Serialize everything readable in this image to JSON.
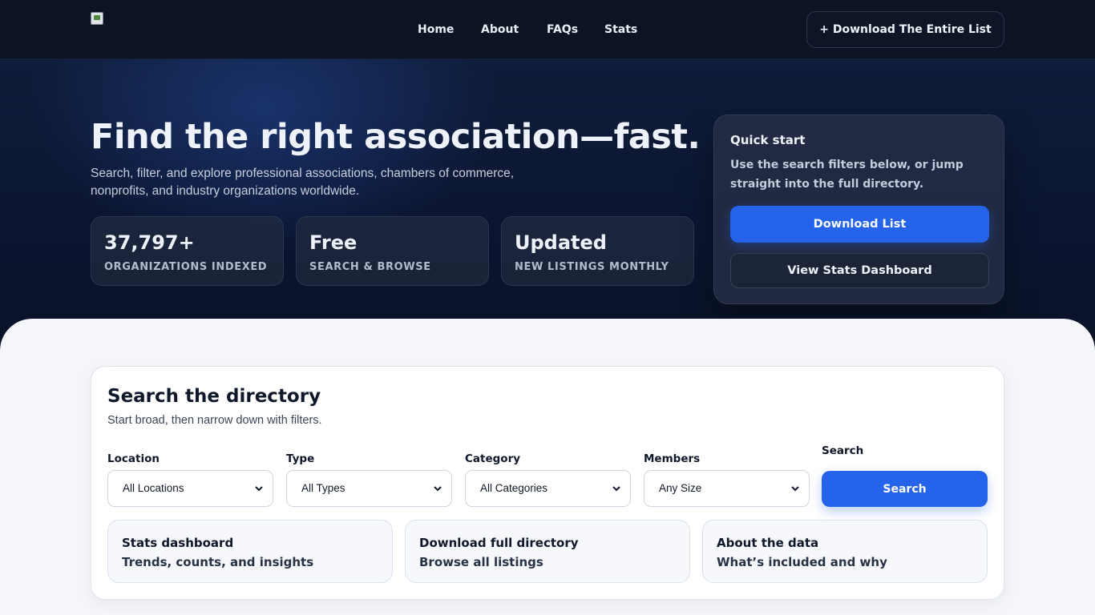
{
  "nav": {
    "links": [
      "Home",
      "About",
      "FAQs",
      "Stats"
    ],
    "cta_label": "+ Download The Entire List"
  },
  "hero": {
    "title": "Find the right association—fast.",
    "subtitle_line1": "Search, filter, and explore professional associations, chambers of commerce,",
    "subtitle_line2": "nonprofits, and industry organizations worldwide.",
    "stats": [
      {
        "value": "37,797+",
        "label": "ORGANIZATIONS INDEXED"
      },
      {
        "value": "Free",
        "label": "SEARCH & BROWSE"
      },
      {
        "value": "Updated",
        "label": "NEW LISTINGS MONTHLY"
      }
    ]
  },
  "quick_start": {
    "title": "Quick start",
    "text": "Use the search filters below, or jump straight into the full directory.",
    "primary_label": "Download List",
    "secondary_label": "View Stats Dashboard"
  },
  "search": {
    "title": "Search the directory",
    "subtitle": "Start broad, then narrow down with filters.",
    "filters": [
      {
        "label": "Location",
        "value": "All Locations"
      },
      {
        "label": "Type",
        "value": "All Types"
      },
      {
        "label": "Category",
        "value": "All Categories"
      },
      {
        "label": "Members",
        "value": "Any Size"
      }
    ],
    "search_label": "Search",
    "search_button": "Search",
    "links": [
      {
        "title": "Stats dashboard",
        "subtitle": "Trends, counts, and insights"
      },
      {
        "title": "Download full directory",
        "subtitle": "Browse all listings"
      },
      {
        "title": "About the data",
        "subtitle": "What’s included and why"
      }
    ]
  },
  "colors": {
    "accent": "#2563eb",
    "nav_bg": "#0c1424",
    "hero_bg": "#0b1530",
    "main_bg": "#f4f6f9"
  },
  "icons": {
    "logo": "broken-image-icon",
    "select": "chevron-down-icon"
  }
}
